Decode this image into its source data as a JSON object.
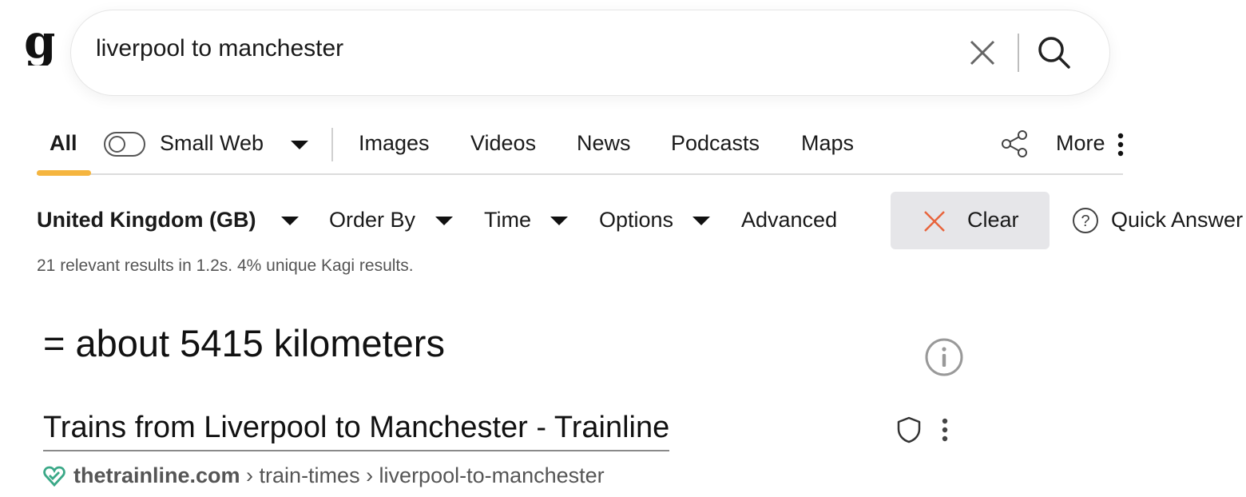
{
  "logo": {
    "letter": "g"
  },
  "search": {
    "query": "liverpool to manchester"
  },
  "tabs": {
    "all": "All",
    "small_web": "Small Web",
    "images": "Images",
    "videos": "Videos",
    "news": "News",
    "podcasts": "Podcasts",
    "maps": "Maps",
    "more": "More"
  },
  "filters": {
    "region": "United Kingdom (GB)",
    "order_by": "Order By",
    "time": "Time",
    "options": "Options",
    "advanced": "Advanced",
    "clear": "Clear",
    "quick_answer": "Quick Answer"
  },
  "stats": "21 relevant results in 1.2s. 4% unique Kagi results.",
  "answer": "= about 5415 kilometers",
  "result": {
    "title": "Trains from Liverpool to Manchester - Trainline",
    "domain": "thetrainline.com",
    "path": " › train-times › liverpool-to-manchester"
  },
  "colors": {
    "accent_underline": "#f5b53f",
    "clear_icon": "#e8643c",
    "favicon": "#3aa887"
  },
  "icons": [
    "kagi-logo",
    "close-icon",
    "search-icon",
    "share-icon",
    "more-vertical-icon",
    "caret-down-icon",
    "help-circle-icon",
    "info-icon",
    "shield-icon",
    "trainline-favicon"
  ]
}
